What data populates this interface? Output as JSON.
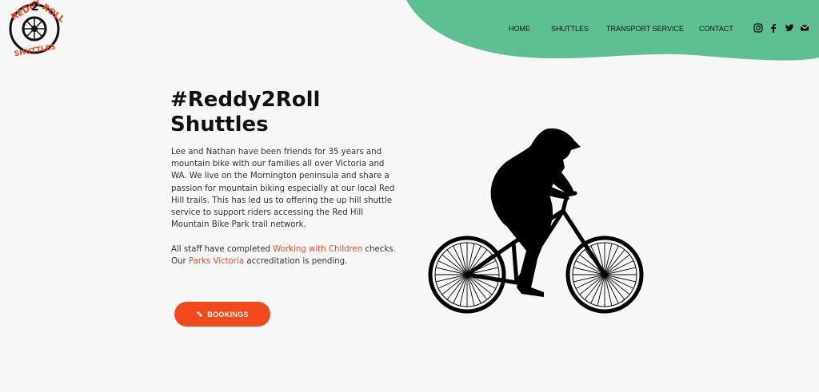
{
  "brand": {
    "logo_text_top": "REDDY",
    "logo_text_num": "2",
    "logo_text_roll": "ROLL",
    "logo_text_bottom": "SHUTTLES",
    "accent_green": "#5ebf92",
    "accent_orange": "#f14a1c"
  },
  "nav": {
    "home": "HOME",
    "shuttles": "SHUTTLES",
    "transport": "TRANSPORT SERVICE",
    "contact": "CONTACT"
  },
  "social": [
    "instagram-icon",
    "facebook-icon",
    "twitter-icon",
    "email-icon"
  ],
  "hero": {
    "title_line1": "#Reddy2Roll",
    "title_line2": "Shuttles",
    "para1": "Lee and Nathan have been friends for 35 years and mountain bike with our families all over Victoria and WA. We live on the Mornington peninsula and share a passion for mountain biking especially at our local Red Hill trails. This has led us to offering the up hill shuttle service to support riders accessing the Red Hill Mountain Bike Park trail network.",
    "para2_a": "All staff have completed ",
    "para2_link1": "Working with Children",
    "para2_b": " checks. Our ",
    "para2_link2": "Parks Victoria",
    "para2_c": " accreditation is pending.",
    "button": "BOOKINGS"
  }
}
